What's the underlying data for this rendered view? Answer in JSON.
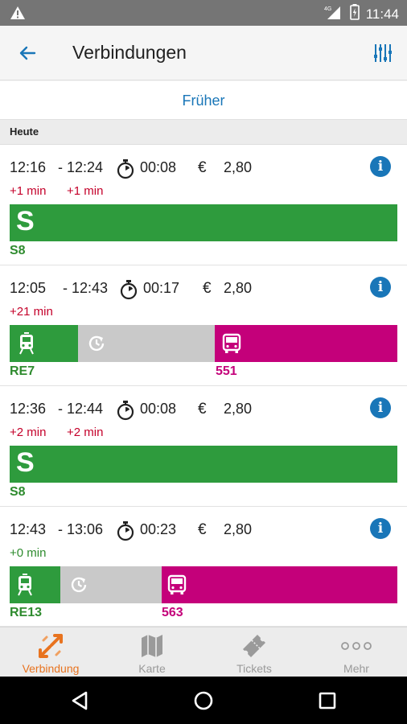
{
  "status_bar": {
    "time": "11:44",
    "network": "4G"
  },
  "app_bar": {
    "title": "Verbindungen"
  },
  "earlier_label": "Früher",
  "section_label": "Heute",
  "colors": {
    "primary_blue": "#1976b8",
    "sbahn_green": "#2e9b3d",
    "walk_gray": "#c9c9c9",
    "bus_magenta": "#c4007a",
    "delay_red": "#c4002a",
    "ontime_green": "#2e8b2e",
    "active_orange": "#e8731f"
  },
  "connections": [
    {
      "departure": "12:16",
      "arrival": "- 12:24",
      "duration": "00:08",
      "currency": "€",
      "price": "2,80",
      "delays": [
        {
          "text": "+1 min",
          "color": "#c4002a"
        },
        {
          "text": "+1 min",
          "color": "#c4002a"
        }
      ],
      "legs": [
        {
          "type": "sbahn",
          "icon": "s-bahn-icon",
          "line": "S8",
          "color": "#2e9b3d"
        }
      ]
    },
    {
      "departure": "12:05",
      "arrival": "- 12:43",
      "duration": "00:17",
      "currency": "€",
      "price": "2,80",
      "delays": [
        {
          "text": "+21 min",
          "color": "#c4002a"
        }
      ],
      "legs": [
        {
          "type": "train",
          "icon": "train-icon",
          "line": "RE7",
          "color": "#2e9b3d"
        },
        {
          "type": "wait",
          "icon": "wait-clock-icon",
          "line": "",
          "color": "#c9c9c9"
        },
        {
          "type": "bus",
          "icon": "bus-icon",
          "line": "551",
          "color": "#c4007a"
        }
      ]
    },
    {
      "departure": "12:36",
      "arrival": "- 12:44",
      "duration": "00:08",
      "currency": "€",
      "price": "2,80",
      "delays": [
        {
          "text": "+2 min",
          "color": "#c4002a"
        },
        {
          "text": "+2 min",
          "color": "#c4002a"
        }
      ],
      "legs": [
        {
          "type": "sbahn",
          "icon": "s-bahn-icon",
          "line": "S8",
          "color": "#2e9b3d"
        }
      ]
    },
    {
      "departure": "12:43",
      "arrival": "- 13:06",
      "duration": "00:23",
      "currency": "€",
      "price": "2,80",
      "delays": [
        {
          "text": "+0 min",
          "color": "#2e8b2e"
        }
      ],
      "legs": [
        {
          "type": "train",
          "icon": "train-icon",
          "line": "RE13",
          "color": "#2e9b3d"
        },
        {
          "type": "wait",
          "icon": "wait-clock-icon",
          "line": "",
          "color": "#c9c9c9"
        },
        {
          "type": "bus",
          "icon": "bus-icon",
          "line": "563",
          "color": "#c4007a"
        }
      ]
    }
  ],
  "bottom_nav": [
    {
      "label": "Verbindung",
      "icon": "connection-arrows-icon",
      "active": true
    },
    {
      "label": "Karte",
      "icon": "map-icon",
      "active": false
    },
    {
      "label": "Tickets",
      "icon": "ticket-icon",
      "active": false
    },
    {
      "label": "Mehr",
      "icon": "more-dots-icon",
      "active": false
    }
  ]
}
